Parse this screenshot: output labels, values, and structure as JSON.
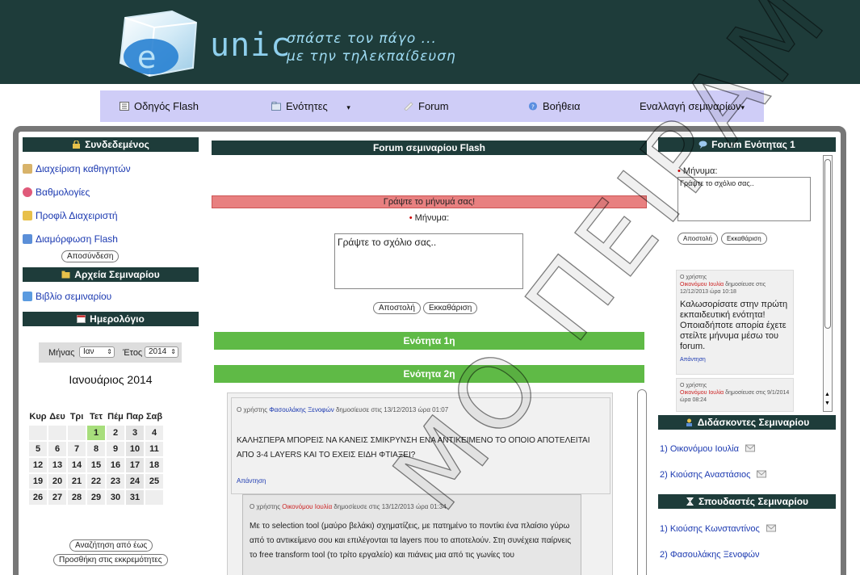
{
  "header": {
    "logo_letter": "e",
    "logo_word": "unic",
    "tagline_1": "σπάστε τον πάγο ...",
    "tagline_2": "με την τηλεκπαίδευση"
  },
  "nav": {
    "items": [
      {
        "label": "Οδηγός Flash",
        "icon": "book-icon"
      },
      {
        "label": "Ενότητες",
        "icon": "folder-icon"
      },
      {
        "label": "Forum",
        "icon": "forum-icon"
      },
      {
        "label": "Βοήθεια",
        "icon": "help-icon"
      },
      {
        "label": "Εναλλαγή σεμιναρίων"
      }
    ]
  },
  "left": {
    "login_title": "Συνδεδεμένος",
    "links": [
      {
        "label": "Διαχείριση καθηγητών"
      },
      {
        "label": "Βαθμολογίες"
      },
      {
        "label": "Προφίλ Διαχειριστή"
      },
      {
        "label": "Διαμόρφωση Flash"
      }
    ],
    "logout": "Αποσύνδεση",
    "files_title": "Αρχεία Σεμιναρίου",
    "book_link": "Βιβλίο σεμιναρίου",
    "calendar_title": "Ημερολόγιο",
    "calendar": {
      "month_label": "Μήνας",
      "month_value": "Ιαν",
      "year_label": "Έτος",
      "year_value": "2014",
      "title": "Ιανουάριος 2014",
      "weekdays": [
        "Κυρ",
        "Δευ",
        "Τρι",
        "Τετ",
        "Πέμ",
        "Παρ",
        "Σαβ"
      ],
      "weeks": [
        [
          "",
          "",
          "",
          "1",
          "2",
          "3",
          "4"
        ],
        [
          "5",
          "6",
          "7",
          "8",
          "9",
          "10",
          "11"
        ],
        [
          "12",
          "13",
          "14",
          "15",
          "16",
          "17",
          "18"
        ],
        [
          "19",
          "20",
          "21",
          "22",
          "23",
          "24",
          "25"
        ],
        [
          "26",
          "27",
          "28",
          "29",
          "30",
          "31",
          ""
        ]
      ],
      "today": "1"
    },
    "search_btn": "Αναζήτηση από έως",
    "add_btn": "Προσθήκη στις εκκρεμότητες"
  },
  "center": {
    "title": "Forum σεμιναρίου Flash",
    "write_prompt": "Γράψτε το μήνυμά σας!",
    "msg_label": "Μήνυμα:",
    "msg_placeholder": "Γράψτε το σχόλιο σας..",
    "send_btn": "Αποστολή",
    "clear_btn": "Εκκαθάριση",
    "section_1": "Ενότητα 1η",
    "section_2": "Ενότητα 2η",
    "posts": [
      {
        "prefix": "Ο χρήστης",
        "author": "Φασουλάκης Ξενοφών",
        "suffix": "δημοσίευσε στις 13/12/2013 ώρα 01:07",
        "body": "ΚΑΛΗΣΠΕΡΑ ΜΠΟΡΕΙΣ ΝΑ ΚΑΝΕΙΣ ΣΜΙΚΡΥΝΣΗ ΕΝΑ ΑΝΤΙΚΕΙΜΕΝΟ ΤΟ ΟΠΟΙΟ ΑΠΟΤΕΛΕΙΤΑΙ ΑΠΟ 3-4 LAYERS ΚΑΙ ΤΟ ΕΧΕΙΣ ΕΙΔΗ ΦΤΙΑΞΕΙ?",
        "reply": "Απάντηση"
      },
      {
        "prefix": "Ο χρήστης",
        "author": "Οικονόμου Ιουλία",
        "suffix": "δημοσίευσε στις 13/12/2013 ώρα 01:34",
        "body": "Με το selection tool (μαύρο βελάκι) σχηματίζεις, με πατημένο το ποντίκι ένα πλαίσιο γύρω από το αντικείμενο σου και επιλέγονται τα layers που το αποτελούν. Στη συνέχεια παίρνεις το free transform tool (το τρίτο εργαλείο) και πιάνεις μια από τις γωνίες του"
      }
    ]
  },
  "right": {
    "forum_title": "Forum Ενότητας 1",
    "msg_label": "Μήνυμα:",
    "msg_placeholder": "Γράψτε το σχόλιο σας..",
    "send_btn": "Αποστολή",
    "clear_btn": "Εκκαθάριση",
    "posts": [
      {
        "prefix": "Ο χρήστης",
        "author": "Οικονόμου Ιουλία",
        "suffix": "δημοσίευσε στις 12/12/2013 ώρα 10:18",
        "body": "Καλωσορίσατε στην πρώτη εκπαιδευτική ενότητα! Οποιαδήποτε απορία έχετε στείλτε μήνυμα μέσω του forum.",
        "reply": "Απάντηση"
      },
      {
        "prefix": "Ο χρήστης",
        "author": "Οικονόμου Ιουλία",
        "suffix": "δημοσίευσε στις 9/1/2014 ώρα 08:24"
      }
    ],
    "teachers_title": "Διδάσκοντες Σεμιναρίου",
    "teachers": [
      "1) Οικονόμου Ιουλία",
      "2) Κιούσης Αναστάσιος"
    ],
    "students_title": "Σπουδαστές Σεμιναρίου",
    "students": [
      "1) Κιούσης Κωνσταντίνος",
      "2) Φασουλάκης Ξενοφών"
    ]
  },
  "watermark": "ΜΟ ΠΕΙΡΑΜ"
}
